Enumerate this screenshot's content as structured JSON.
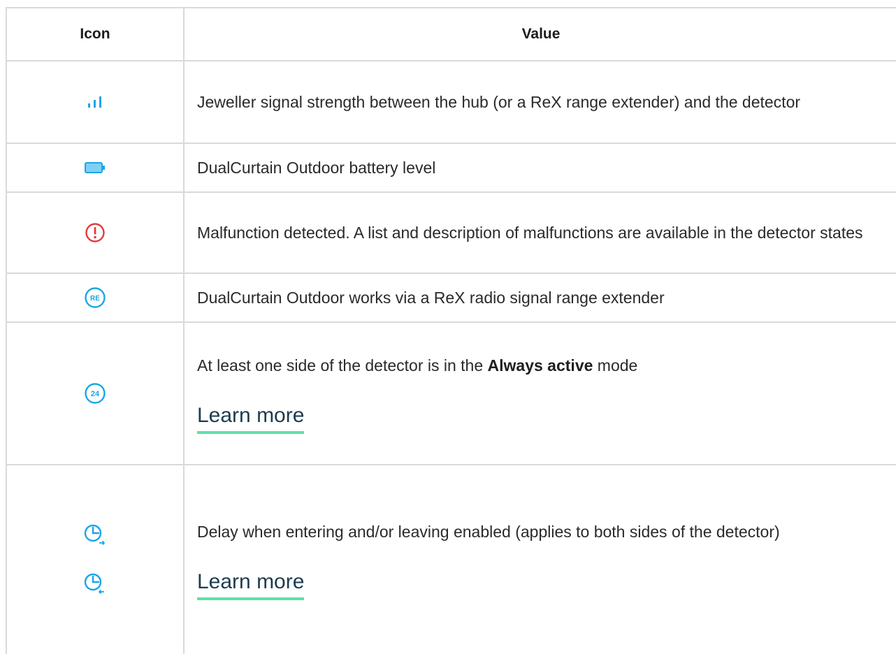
{
  "header": {
    "icon_col": "Icon",
    "value_col": "Value"
  },
  "rows": [
    {
      "icon": "signal-strength-icon",
      "text": "Jeweller signal strength between the hub (or a ReX range extender) and the detector"
    },
    {
      "icon": "battery-icon",
      "text": "DualCurtain Outdoor battery level"
    },
    {
      "icon": "malfunction-icon",
      "text": "Malfunction detected. A list and description of malfunctions are available in the detector states"
    },
    {
      "icon": "rex-icon",
      "icon_text": "RE",
      "text": "DualCurtain Outdoor works via a ReX radio signal range extender"
    },
    {
      "icon": "always-active-icon",
      "icon_text": "24",
      "text_before": "At least one side of the detector is in the ",
      "text_bold": "Always active",
      "text_after": " mode",
      "link": "Learn more"
    },
    {
      "icons": [
        "entry-delay-icon",
        "exit-delay-icon"
      ],
      "text": "Delay when entering and/or leaving enabled (applies to both sides of the detector)",
      "link": "Learn more"
    }
  ],
  "colors": {
    "accent_blue": "#1aa6e6",
    "error_red": "#e23c3c",
    "link_underline": "#5fe0a8",
    "border": "#d9d9d9"
  }
}
